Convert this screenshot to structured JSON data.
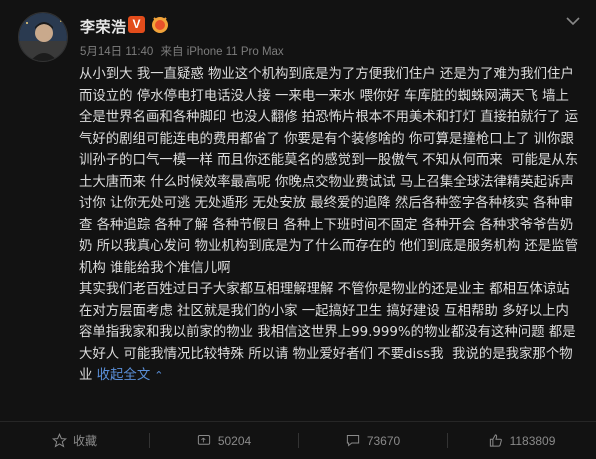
{
  "post": {
    "author": "李荣浩",
    "verified_badge": "V",
    "date": "5月14日 11:40",
    "source": "来自 iPhone 11 Pro Max",
    "body": "从小到大 我一直疑惑 物业这个机构到底是为了方便我们住户 还是为了难为我们住户而设立的 停水停电打电话没人接 一来电一来水 喂你好 车库脏的蜘蛛网满天飞 墙上全是世界名画和各种脚印 也没人翻修 拍恐怖片根本不用美术和打灯 直接拍就行了 运气好的剧组可能连电的费用都省了 你要是有个装修啥的 你可算是撞枪口上了 训你跟训孙子的口气一模一样 而且你还能莫名的感觉到一股傲气 不知从何而来  可能是从东土大唐而来 什么时候效率最高呢 你晚点交物业费试试 马上召集全球法律精英起诉声讨你 让你无处可逃 无处遁形 无处安放 最终爱的追降 然后各种签字各种核实 各种审查 各种追踪 各种了解 各种节假日 各种上下班时间不固定 各种开会 各种求爷爷告奶奶 所以我真心发问 物业机构到底是为了什么而存在的 他们到底是服务机构 还是监管机构 谁能给我个准信儿啊\n其实我们老百姓过日子大家都互相理解理解 不管你是物业的还是业主 都相互体谅站在对方层面考虑 社区就是我们的小家 一起搞好卫生 搞好建设 互相帮助 多好以上内容单指我家和我以前家的物业 我相信这世界上99.999%的物业都没有这种问题 都是大好人 可能我情况比较特殊 所以请 物业爱好者们 不要diss我  我说的是我家那个物业 ",
    "collapse_label": "收起全文",
    "collapse_arrow": "⌃"
  },
  "actions": {
    "favorite_label": "收藏",
    "repost_count": "50204",
    "comment_count": "73670",
    "like_count": "1183809"
  },
  "colors": {
    "background": "#121212",
    "link": "#5a8fd8",
    "verified_badge": "#e34c1b"
  },
  "icons": [
    "chevron-down-icon",
    "star-icon",
    "repost-icon",
    "comment-icon",
    "like-icon"
  ]
}
